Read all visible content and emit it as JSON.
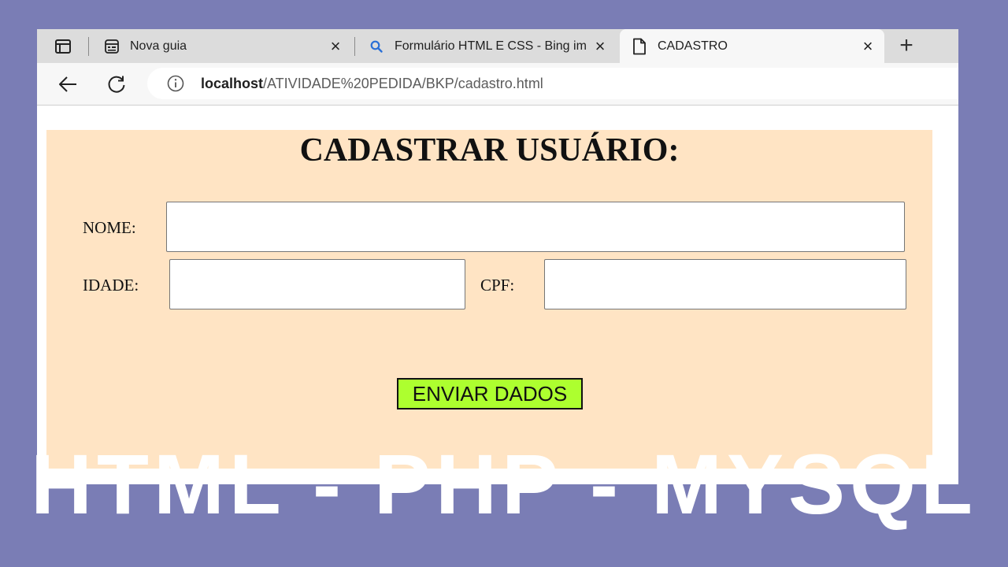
{
  "tabs": [
    {
      "label": "Nova guia",
      "icon": "new-tab-page-icon",
      "active": false
    },
    {
      "label": "Formulário HTML E CSS - Bing im",
      "icon": "search-icon",
      "active": false
    },
    {
      "label": "CADASTRO",
      "icon": "document-icon",
      "active": true
    }
  ],
  "address": {
    "host": "localhost",
    "path": "/ATIVIDADE%20PEDIDA/BKP/cadastro.html"
  },
  "form": {
    "title": "CADASTRAR USUÁRIO:",
    "nome_label": "NOME:",
    "idade_label": "IDADE:",
    "cpf_label": "CPF:",
    "submit_label": "ENVIAR DADOS",
    "panel_color": "#ffe4c4",
    "button_color": "#adff2f"
  },
  "overlay": {
    "text": "HTML - PHP - MYSQL"
  },
  "colors": {
    "background": "#7a7db5"
  }
}
